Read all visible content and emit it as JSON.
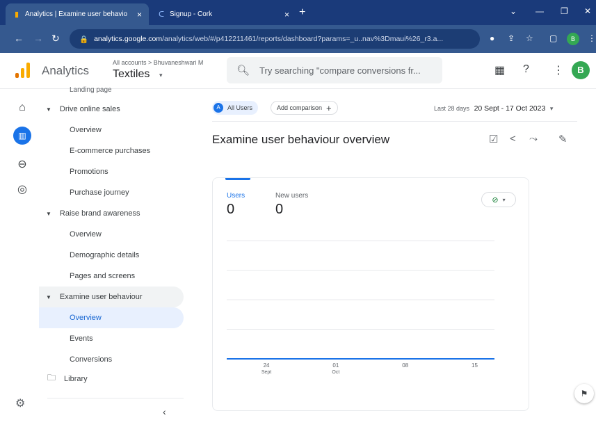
{
  "browser": {
    "tabs": [
      {
        "title": "Analytics | Examine user behavio",
        "close": "×"
      },
      {
        "title": "Signup - Cork",
        "close": "×"
      }
    ],
    "new_tab": "+",
    "url_host": "analytics.google.com",
    "url_path": "/analytics/web/#/p412211461/reports/dashboard?params=_u..nav%3Dmaui%26_r3.a...",
    "profile_initial": "B"
  },
  "header": {
    "app_name": "Analytics",
    "account_path": "All accounts > Bhuvaneshwari M",
    "property": "Textiles",
    "search_placeholder": "Try searching \"compare conversions fr...",
    "avatar_initial": "B"
  },
  "sidebar": {
    "cut_item": "Landing page",
    "sections": [
      {
        "label": "Drive online sales",
        "items": [
          "Overview",
          "E-commerce purchases",
          "Promotions",
          "Purchase journey"
        ]
      },
      {
        "label": "Raise brand awareness",
        "items": [
          "Overview",
          "Demographic details",
          "Pages and screens"
        ]
      },
      {
        "label": "Examine user behaviour",
        "items": [
          "Overview",
          "Events",
          "Conversions"
        ]
      }
    ],
    "library": "Library",
    "collapse": "‹"
  },
  "main": {
    "all_users": "All Users",
    "all_users_badge": "A",
    "add_comparison": "Add comparison",
    "date_prefix": "Last 28 days",
    "date_range": "20 Sept - 17 Oct 2023",
    "title": "Examine user behaviour overview",
    "metrics": [
      {
        "label": "Users",
        "value": "0"
      },
      {
        "label": "New users",
        "value": "0"
      }
    ],
    "check_icon": "⊘"
  },
  "chart_data": {
    "type": "line",
    "x_ticks": [
      {
        "top": "24",
        "bottom": "Sept"
      },
      {
        "top": "01",
        "bottom": "Oct"
      },
      {
        "top": "08",
        "bottom": ""
      },
      {
        "top": "15",
        "bottom": ""
      }
    ],
    "series": [
      {
        "values": [
          0,
          0,
          0,
          0,
          0,
          0,
          0,
          0,
          0,
          0,
          0,
          0,
          0,
          0,
          0,
          0,
          0,
          0,
          0,
          0,
          0,
          0,
          0,
          0,
          0,
          0,
          0,
          0
        ]
      }
    ],
    "ylim": [
      0,
      4
    ],
    "grid": true,
    "colors": {
      "line": "#1a73e8",
      "grid": "#e8eaed"
    }
  }
}
